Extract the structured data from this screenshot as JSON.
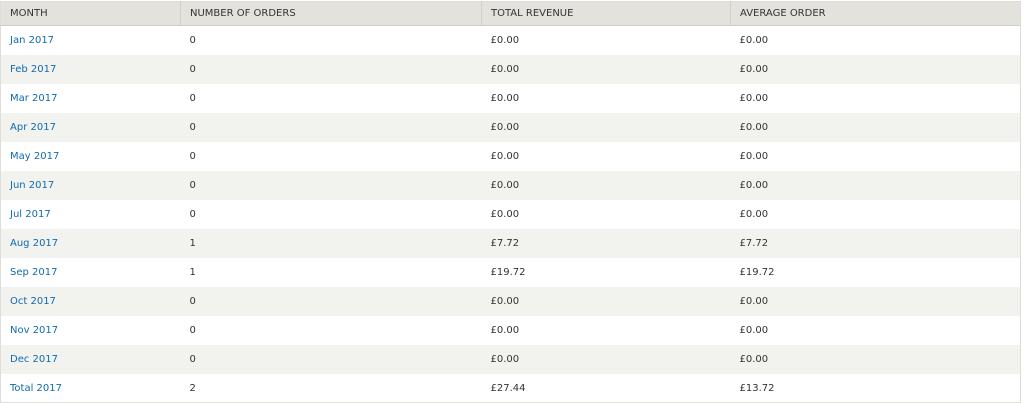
{
  "table": {
    "headers": {
      "month": "MONTH",
      "orders": "NUMBER OF ORDERS",
      "revenue": "TOTAL REVENUE",
      "average": "AVERAGE ORDER"
    },
    "rows": [
      {
        "month": "Jan 2017",
        "orders": "0",
        "revenue": "£0.00",
        "average": "£0.00"
      },
      {
        "month": "Feb 2017",
        "orders": "0",
        "revenue": "£0.00",
        "average": "£0.00"
      },
      {
        "month": "Mar 2017",
        "orders": "0",
        "revenue": "£0.00",
        "average": "£0.00"
      },
      {
        "month": "Apr 2017",
        "orders": "0",
        "revenue": "£0.00",
        "average": "£0.00"
      },
      {
        "month": "May 2017",
        "orders": "0",
        "revenue": "£0.00",
        "average": "£0.00"
      },
      {
        "month": "Jun 2017",
        "orders": "0",
        "revenue": "£0.00",
        "average": "£0.00"
      },
      {
        "month": "Jul 2017",
        "orders": "0",
        "revenue": "£0.00",
        "average": "£0.00"
      },
      {
        "month": "Aug 2017",
        "orders": "1",
        "revenue": "£7.72",
        "average": "£7.72"
      },
      {
        "month": "Sep 2017",
        "orders": "1",
        "revenue": "£19.72",
        "average": "£19.72"
      },
      {
        "month": "Oct 2017",
        "orders": "0",
        "revenue": "£0.00",
        "average": "£0.00"
      },
      {
        "month": "Nov 2017",
        "orders": "0",
        "revenue": "£0.00",
        "average": "£0.00"
      },
      {
        "month": "Dec 2017",
        "orders": "0",
        "revenue": "£0.00",
        "average": "£0.00"
      },
      {
        "month": "Total 2017",
        "orders": "2",
        "revenue": "£27.44",
        "average": "£13.72"
      }
    ]
  },
  "colors": {
    "header_bg": "#e3e2dc",
    "row_even_bg": "#f2f2ee",
    "row_odd_bg": "#ffffff",
    "link": "#0f6bb0",
    "text": "#333333"
  }
}
